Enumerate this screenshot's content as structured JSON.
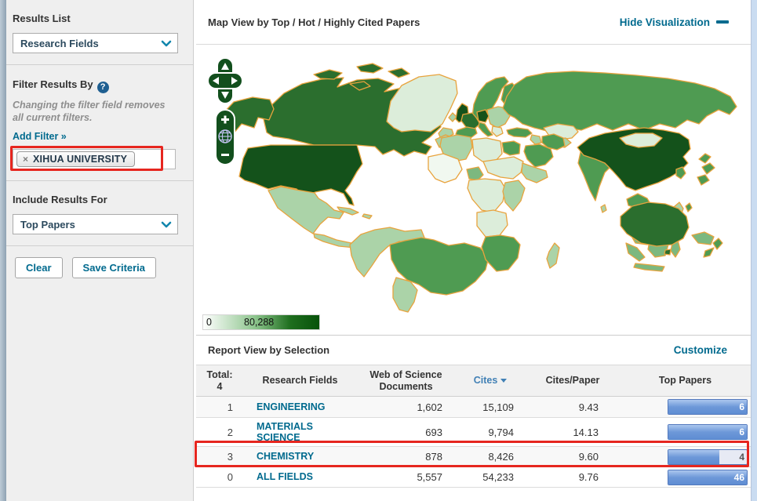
{
  "sidebar": {
    "results_list": {
      "label": "Results List",
      "selected": "Research Fields"
    },
    "filter": {
      "label": "Filter Results By",
      "help": "?",
      "note": "Changing the filter field removes all current filters.",
      "add_filter": "Add Filter »",
      "active_filter": {
        "remove": "×",
        "value": "XIHUA UNIVERSITY"
      }
    },
    "include": {
      "label": "Include Results For",
      "selected": "Top Papers"
    },
    "buttons": {
      "clear": "Clear",
      "save": "Save Criteria"
    }
  },
  "map_section": {
    "title": "Map View by Top / Hot / Highly Cited Papers",
    "hide_link": "Hide Visualization",
    "legend": {
      "min": "0",
      "max": "80,288"
    }
  },
  "map": {
    "type": "choropleth",
    "value_range": [
      0,
      80288
    ],
    "border_color": "#E8A33D",
    "palette": {
      "highest": "#14521B",
      "high": "#2B6E2E",
      "medium": "#4F9B52",
      "medium_low": "#7CB87F",
      "low": "#ABD3A8",
      "very_low": "#DCEDDA",
      "minimal": "#F1F8F0"
    },
    "regions": {
      "usa": "highest",
      "china": "highest",
      "germany": "highest",
      "uk": "highest",
      "canada": "high",
      "alaska": "high",
      "arctic1": "high",
      "arctic2": "high",
      "arctic3": "high",
      "arctic4": "high",
      "australia": "high",
      "tasmania": "high",
      "france": "high",
      "russia": "medium",
      "brazil": "medium",
      "scandinavia": "medium",
      "finland": "medium",
      "japan1": "medium",
      "japan2": "medium",
      "japan3": "medium",
      "korea": "medium",
      "taiwan": "medium",
      "india": "medium",
      "iberia": "medium",
      "italy": "medium",
      "iran": "medium",
      "saudi": "medium",
      "turkey": "medium",
      "egypt": "medium",
      "south_africa": "medium",
      "indochina": "medium",
      "nz1": "medium",
      "nz2": "medium",
      "nigeria": "medium_low",
      "malaysia": "medium_low",
      "sumatra": "medium_low",
      "java": "medium_low",
      "borneo": "medium_low",
      "sulawesi": "medium_low",
      "new_guinea": "medium_low",
      "mexico": "low",
      "centam": "low",
      "caribbean1": "low",
      "caribbean2": "low",
      "sa_north": "low",
      "argentina": "low",
      "ireland": "low",
      "iceland": "low",
      "east_europe": "low",
      "central_asia": "low",
      "morocco": "low",
      "algeria": "low",
      "horn": "low",
      "east_africa": "low",
      "madagascar": "low",
      "philippines": "low",
      "iraq": "low",
      "sri_lanka": "low",
      "greenland": "very_low",
      "kazakhstan": "very_low",
      "libya": "very_low",
      "sudan": "very_low",
      "congo": "very_low",
      "angola": "very_low",
      "balkans": "very_low",
      "mongolia": "very_low",
      "west_africa": "minimal"
    }
  },
  "report": {
    "title": "Report View by Selection",
    "customize_link": "Customize",
    "table": {
      "total_label": "Total:",
      "total_value": "4",
      "col_field": "Research Fields",
      "col_docs": "Web of Science Documents",
      "col_cites": "Cites",
      "col_cpp": "Cites/Paper",
      "col_top": "Top Papers",
      "sorted_by": "Cites",
      "rows": [
        {
          "rank": "1",
          "field": "ENGINEERING",
          "documents": "1,602",
          "cites": "15,109",
          "cites_per_paper": "9.43",
          "top_papers": "6",
          "bar_fill_pct": 100
        },
        {
          "rank": "2",
          "field": "MATERIALS SCIENCE",
          "documents": "693",
          "cites": "9,794",
          "cites_per_paper": "14.13",
          "top_papers": "6",
          "bar_fill_pct": 100
        },
        {
          "rank": "3",
          "field": "CHEMISTRY",
          "documents": "878",
          "cites": "8,426",
          "cites_per_paper": "9.60",
          "top_papers": "4",
          "bar_fill_pct": 65
        },
        {
          "rank": "0",
          "field": "ALL FIELDS",
          "documents": "5,557",
          "cites": "54,233",
          "cites_per_paper": "9.76",
          "top_papers": "46",
          "bar_fill_pct": 100
        }
      ]
    }
  },
  "colors": {
    "accent_teal": "#006A8E",
    "annotation_red": "#E6261F",
    "bar_blue": "#6D98D8",
    "header_link_blue": "#4180B5"
  }
}
